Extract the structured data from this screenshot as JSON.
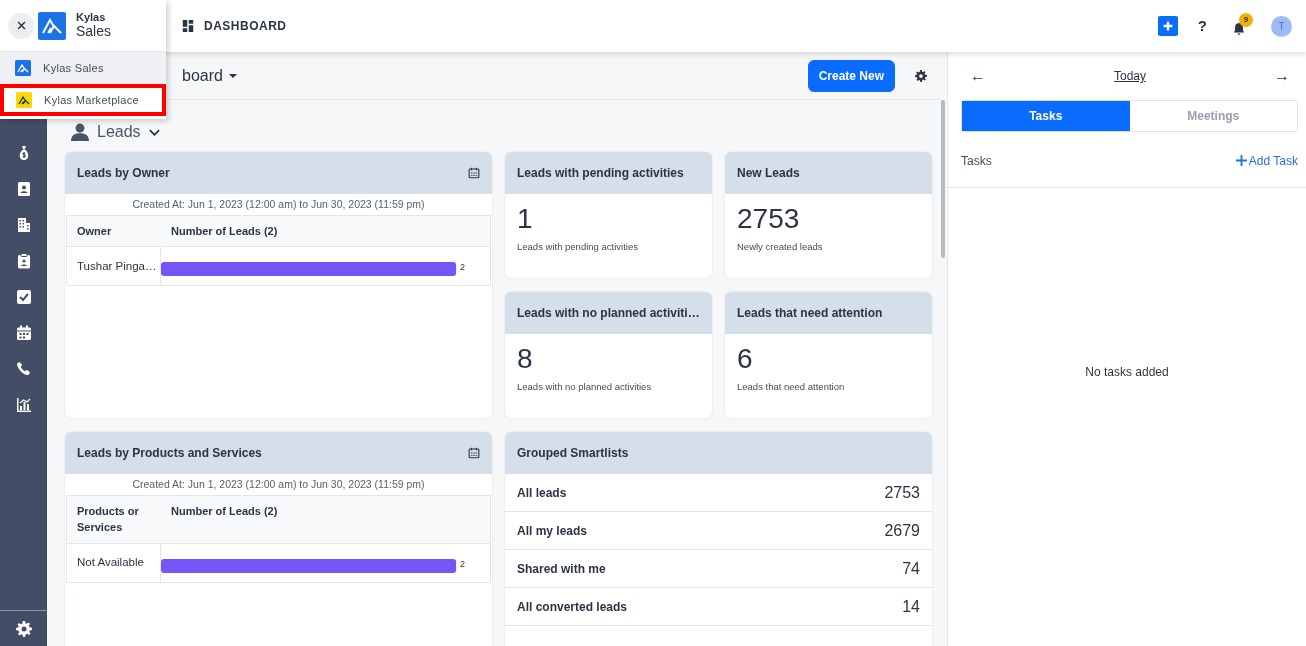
{
  "app_menu": {
    "brand_top": "Kylas",
    "brand_bottom": "Sales",
    "items": [
      {
        "label": "Kylas Sales",
        "color": "#1a73e8",
        "selected": true,
        "highlighted": false
      },
      {
        "label": "Kylas Marketplace",
        "color": "#f5d90a",
        "selected": false,
        "highlighted": true
      }
    ]
  },
  "header": {
    "section": "DASHBOARD",
    "help": "?",
    "notification_count": "9",
    "avatar": "T"
  },
  "sidebar": {
    "items": [
      {
        "kind": "money-bag"
      },
      {
        "kind": "contact"
      },
      {
        "kind": "building"
      },
      {
        "kind": "clipboard"
      },
      {
        "kind": "task"
      },
      {
        "kind": "calendar"
      },
      {
        "kind": "phone"
      },
      {
        "kind": "report"
      }
    ]
  },
  "toolbar": {
    "title": "board",
    "create_button": "Create New"
  },
  "section": {
    "label": "Leads"
  },
  "widgets": [
    {
      "kind": "chart_table",
      "title": "Leads by Owner",
      "subtitle": "Created At: Jun 1, 2023 (12:00 am) to Jun 30, 2023 (11:59 pm)",
      "columns": [
        "Owner",
        "Number of Leads (2)"
      ],
      "chart_data": {
        "type": "bar",
        "orientation": "horizontal",
        "categories": [
          "Tushar Pinga…"
        ],
        "values": [
          2
        ],
        "data_labels": true
      }
    },
    {
      "kind": "metric",
      "title": "Leads with pending activities",
      "value": "1",
      "caption": "Leads with pending activities"
    },
    {
      "kind": "metric",
      "title": "New Leads",
      "value": "2753",
      "caption": "Newly created leads"
    },
    {
      "kind": "metric",
      "title": "Leads with no planned activiti…",
      "value": "8",
      "caption": "Leads with no planned activities"
    },
    {
      "kind": "metric",
      "title": "Leads that need attention",
      "value": "6",
      "caption": "Leads that need attention"
    },
    {
      "kind": "chart_table",
      "title": "Leads by Products and Services",
      "subtitle": "Created At: Jun 1, 2023 (12:00 am) to Jun 30, 2023 (11:59 pm)",
      "columns": [
        "Products or Services",
        "Number of Leads (2)"
      ],
      "chart_data": {
        "type": "bar",
        "orientation": "horizontal",
        "categories": [
          "Not Available"
        ],
        "values": [
          2
        ],
        "data_labels": true
      }
    },
    {
      "kind": "smartlist",
      "title": "Grouped Smartlists",
      "rows": [
        {
          "label": "All leads",
          "count": "2753"
        },
        {
          "label": "All my leads",
          "count": "2679"
        },
        {
          "label": "Shared with me",
          "count": "74"
        },
        {
          "label": "All converted leads",
          "count": "14"
        }
      ]
    }
  ],
  "right_panel": {
    "prev": "←",
    "date": "Today",
    "next": "→",
    "tabs": [
      {
        "label": "Tasks",
        "selected": true
      },
      {
        "label": "Meetings",
        "selected": false
      }
    ],
    "list_title": "Tasks",
    "add_button": "Add Task",
    "empty_text": "No tasks added"
  }
}
